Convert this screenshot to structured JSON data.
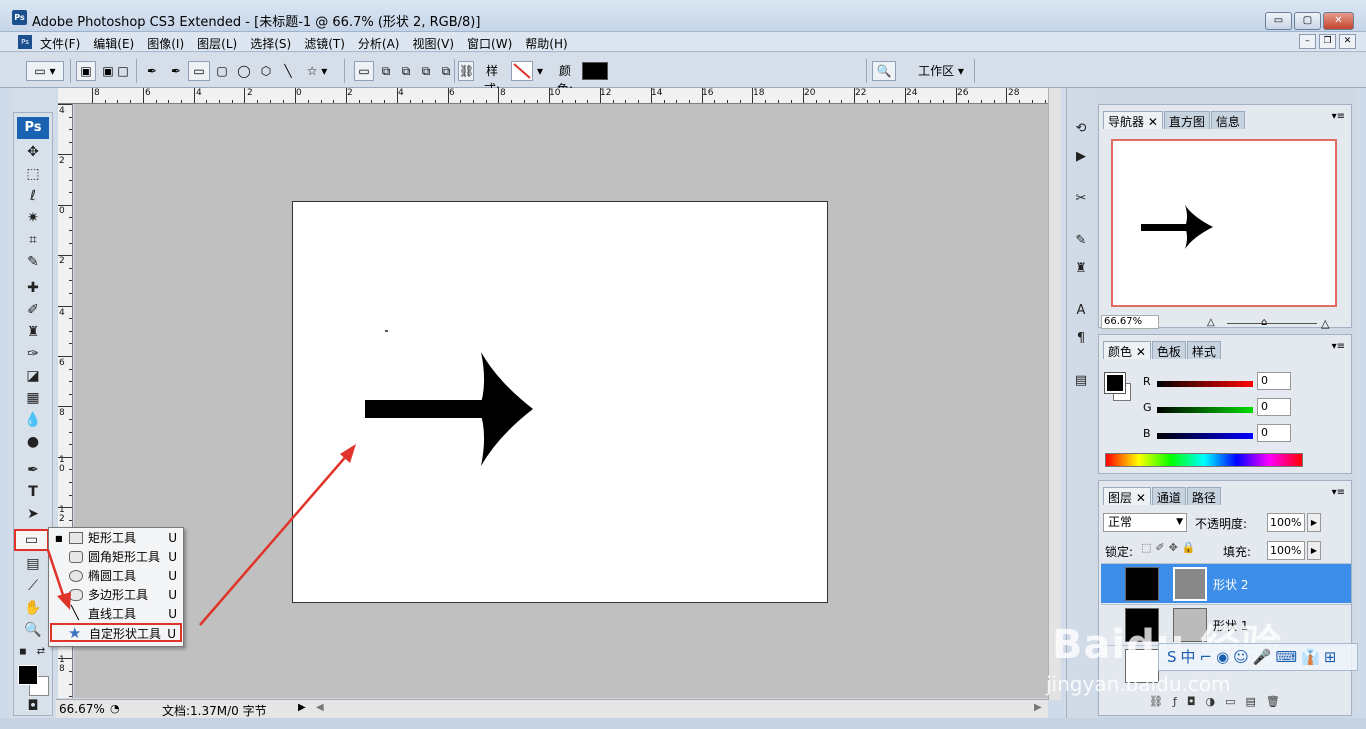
{
  "window": {
    "title": "Adobe Photoshop CS3 Extended - [未标题-1 @ 66.7% (形状 2, RGB/8)]",
    "app_badge": "Ps",
    "btn_min": "▭",
    "btn_restore": "▢",
    "btn_close": "✕"
  },
  "menu": {
    "items": [
      "文件(F)",
      "编辑(E)",
      "图像(I)",
      "图层(L)",
      "选择(S)",
      "滤镜(T)",
      "分析(A)",
      "视图(V)",
      "窗口(W)",
      "帮助(H)"
    ]
  },
  "options": {
    "style_label": "样式:",
    "color_label": "颜色:",
    "workspace_label": "工作区",
    "color_swatch": "#000000"
  },
  "ruler": {
    "top_labels": [
      "8",
      "6",
      "4",
      "2",
      "0",
      "2",
      "4",
      "6",
      "8",
      "10",
      "12",
      "14",
      "16",
      "18",
      "20",
      "22",
      "24",
      "26",
      "28"
    ],
    "left_labels": [
      "4",
      "2",
      "0",
      "2",
      "4",
      "6",
      "8",
      "1\n0",
      "1\n2",
      "1\n4",
      "1\n6",
      "1\n8"
    ]
  },
  "toolbox": {
    "badge": "Ps",
    "tools": [
      "move-tool-icon",
      "marquee-tool-icon",
      "lasso-tool-icon",
      "magic-wand-icon",
      "crop-tool-icon",
      "slice-tool-icon",
      "healing-brush-icon",
      "brush-tool-icon",
      "clone-stamp-icon",
      "history-brush-icon",
      "eraser-icon",
      "gradient-icon",
      "blur-icon",
      "dodge-icon",
      "pen-tool-icon",
      "type-tool-icon",
      "path-select-icon",
      "rectangle-tool-icon",
      "notes-icon",
      "eyedropper-icon",
      "hand-tool-icon",
      "zoom-tool-icon"
    ]
  },
  "flyout": {
    "items": [
      {
        "label": "矩形工具",
        "key": "U"
      },
      {
        "label": "圆角矩形工具",
        "key": "U"
      },
      {
        "label": "椭圆工具",
        "key": "U"
      },
      {
        "label": "多边形工具",
        "key": "U"
      },
      {
        "label": "直线工具",
        "key": "U"
      },
      {
        "label": "自定形状工具",
        "key": "U"
      }
    ]
  },
  "status": {
    "zoom": "66.67%",
    "doc_info": "文档:1.37M/0 字节"
  },
  "navigator": {
    "tabs": [
      "导航器",
      "直方图",
      "信息"
    ],
    "zoom": "66.67%"
  },
  "color_panel": {
    "tabs": [
      "颜色",
      "色板",
      "样式"
    ],
    "channels": [
      {
        "name": "R",
        "value": "0",
        "color": "#cc0000"
      },
      {
        "name": "G",
        "value": "0",
        "color": "#00aa00"
      },
      {
        "name": "B",
        "value": "0",
        "color": "#0000cc"
      }
    ]
  },
  "layers_panel": {
    "tabs": [
      "图层",
      "通道",
      "路径"
    ],
    "blend_mode": "正常",
    "opacity_label": "不透明度:",
    "opacity_value": "100%",
    "lock_label": "锁定:",
    "fill_label": "填充:",
    "fill_value": "100%",
    "layers": [
      {
        "name": "形状 2",
        "selected": true
      },
      {
        "name": "形状 1",
        "selected": false
      }
    ]
  },
  "watermark": {
    "brand": "Baidu 经验",
    "url": "jingyan.baidu.com"
  },
  "colors": {
    "highlight": "#e0342a",
    "layer_selected": "#3d8ee8",
    "app_blue": "#1a63b3"
  }
}
